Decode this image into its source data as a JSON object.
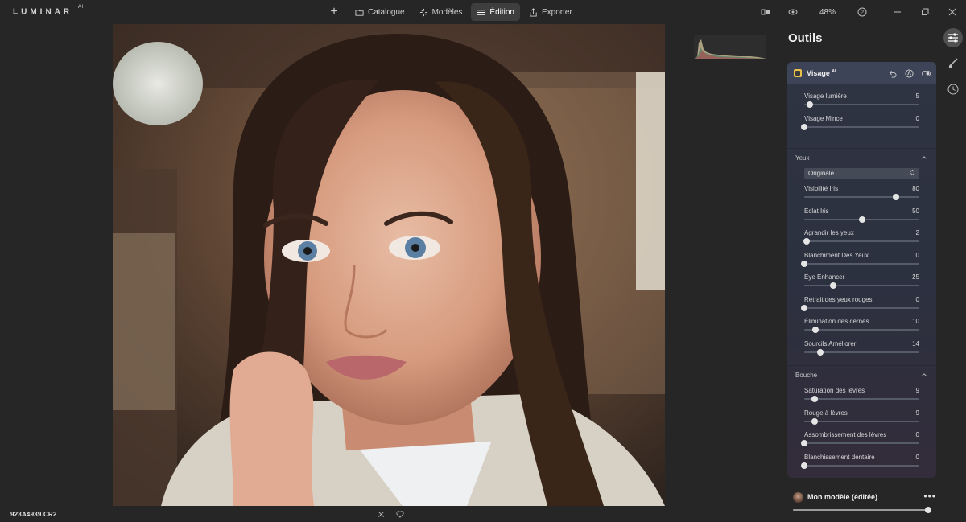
{
  "app": {
    "logo": "LUMINAR",
    "logo_suffix": "AI"
  },
  "nav": {
    "tabs": [
      {
        "label": "Catalogue",
        "icon": "folder-icon",
        "active": false
      },
      {
        "label": "Modèles",
        "icon": "sparkle-icon",
        "active": false
      },
      {
        "label": "Édition",
        "icon": "sliders-icon",
        "active": true
      },
      {
        "label": "Exporter",
        "icon": "share-icon",
        "active": false
      }
    ]
  },
  "toolbar": {
    "zoom": "48%"
  },
  "photo": {
    "filename": "923A4939.CR2"
  },
  "panel": {
    "title": "Outils",
    "tool": {
      "title": "Visage",
      "title_suffix": "AI"
    },
    "face_sliders": [
      {
        "label": "Visage lumière",
        "value": "5",
        "fraction": 0.05
      },
      {
        "label": "Visage Mince",
        "value": "0",
        "fraction": 0.0
      }
    ],
    "eyes": {
      "title": "Yeux",
      "select": "Originale",
      "sliders": [
        {
          "label": "Visibilité Iris",
          "value": "80",
          "fraction": 0.8
        },
        {
          "label": "Éclat Iris",
          "value": "50",
          "fraction": 0.5
        },
        {
          "label": "Agrandir les yeux",
          "value": "2",
          "fraction": 0.02
        },
        {
          "label": "Blanchiment Des Yeux",
          "value": "0",
          "fraction": 0.0
        },
        {
          "label": "Eye Enhancer",
          "value": "25",
          "fraction": 0.25
        },
        {
          "label": "Retrait des yeux rouges",
          "value": "0",
          "fraction": 0.0
        },
        {
          "label": "Élimination des cernes",
          "value": "10",
          "fraction": 0.1
        },
        {
          "label": "Sourcils Améliorer",
          "value": "14",
          "fraction": 0.14
        }
      ]
    },
    "mouth": {
      "title": "Bouche",
      "sliders": [
        {
          "label": "Saturation des lèvres",
          "value": "9",
          "fraction": 0.09
        },
        {
          "label": "Rouge à lèvres",
          "value": "9",
          "fraction": 0.09
        },
        {
          "label": "Assombrissement des lèvres",
          "value": "0",
          "fraction": 0.0
        },
        {
          "label": "Blanchissement dentaire",
          "value": "0",
          "fraction": 0.0
        }
      ]
    }
  },
  "preset": {
    "name": "Mon modèle (éditée)",
    "more": "•••",
    "amount_fraction": 1.0
  },
  "colors": {
    "accent_badge": "#e8c24a",
    "panel_header": "#3d4457"
  }
}
